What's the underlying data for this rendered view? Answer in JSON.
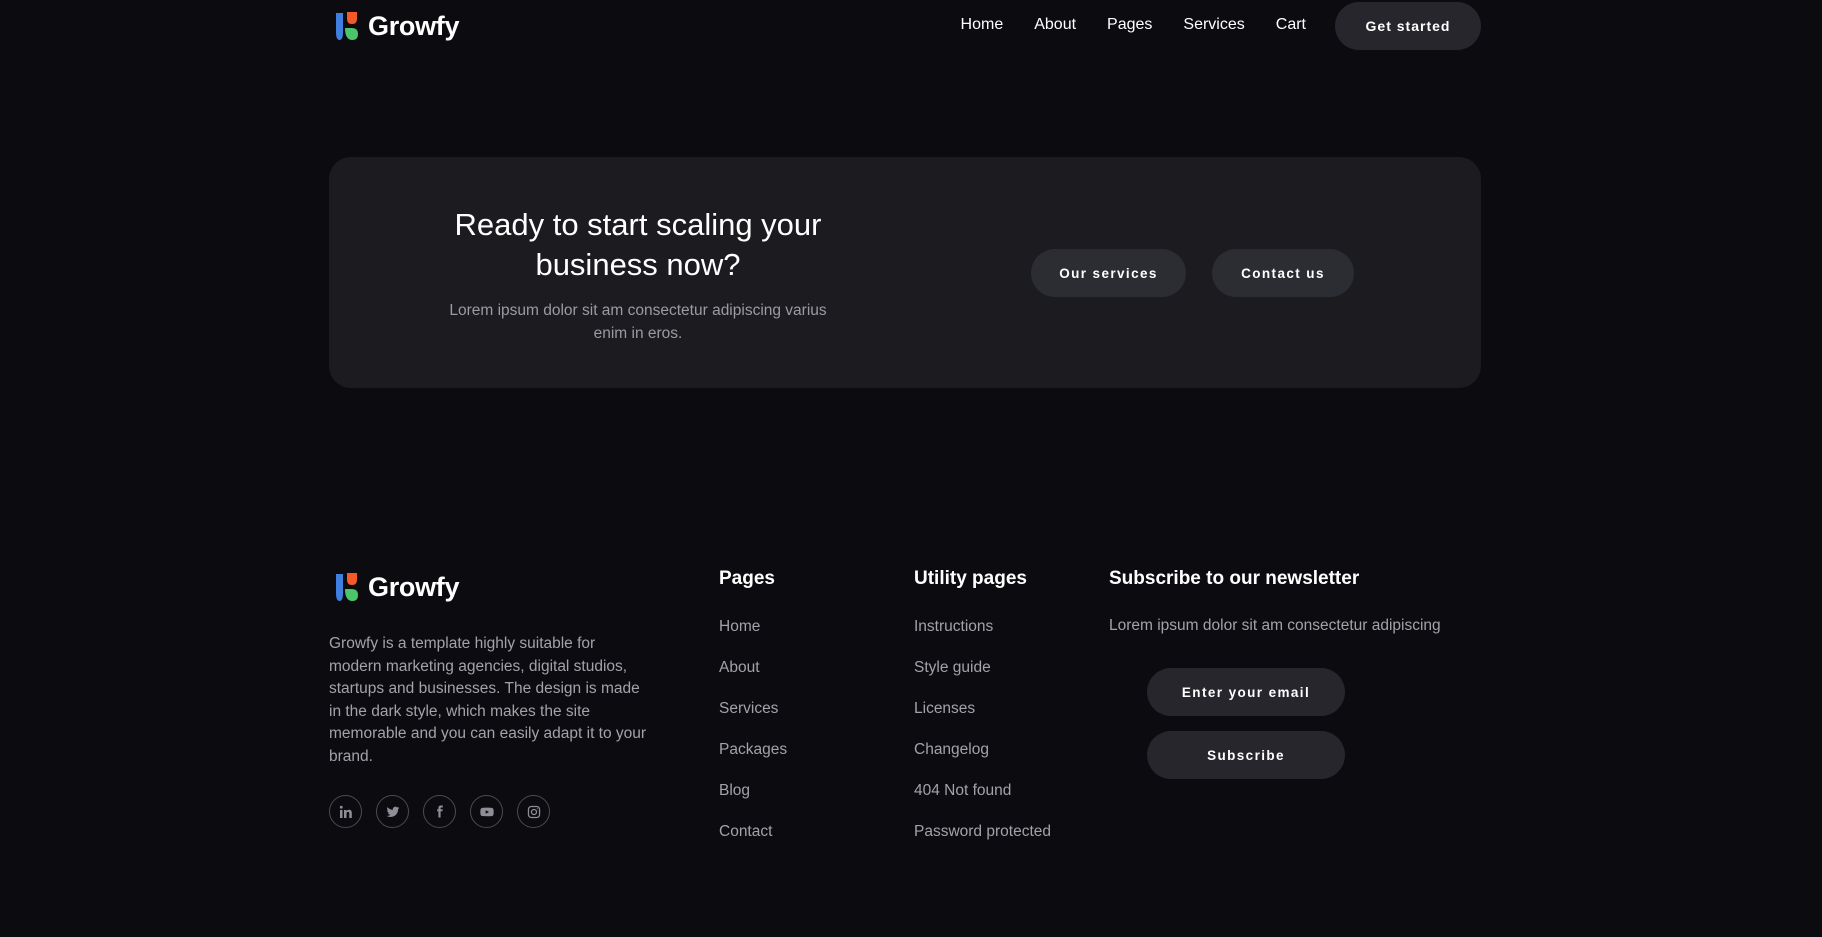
{
  "brand": {
    "name": "Growfy",
    "colors": {
      "blue": "#3f7fe0",
      "orange": "#f25a2a",
      "green": "#4cc46a"
    }
  },
  "nav": {
    "links": [
      "Home",
      "About",
      "Pages",
      "Services",
      "Cart"
    ],
    "cta": "Get started"
  },
  "cta": {
    "title": "Ready to start scaling your business now?",
    "subtitle": "Lorem ipsum dolor sit am consectetur adipiscing varius enim in eros.",
    "buttons": [
      "Our services",
      "Contact us"
    ]
  },
  "footer": {
    "description": "Growfy is a template highly suitable for modern marketing agencies, digital studios, startups and businesses. The design is made in the dark style, which makes the site memorable and you can easily adapt it to your brand.",
    "socials": [
      "linkedin-icon",
      "twitter-icon",
      "facebook-icon",
      "youtube-icon",
      "instagram-icon"
    ],
    "pages": {
      "title": "Pages",
      "links": [
        "Home",
        "About",
        "Services",
        "Packages",
        "Blog",
        "Contact"
      ]
    },
    "utility": {
      "title": "Utility pages",
      "links": [
        "Instructions",
        "Style guide",
        "Licenses",
        "Changelog",
        "404 Not found",
        "Password protected"
      ]
    },
    "newsletter": {
      "title": "Subscribe to our newsletter",
      "subtitle": "Lorem ipsum dolor sit am consectetur adipiscing",
      "placeholder": "Enter your email",
      "button": "Subscribe"
    }
  }
}
